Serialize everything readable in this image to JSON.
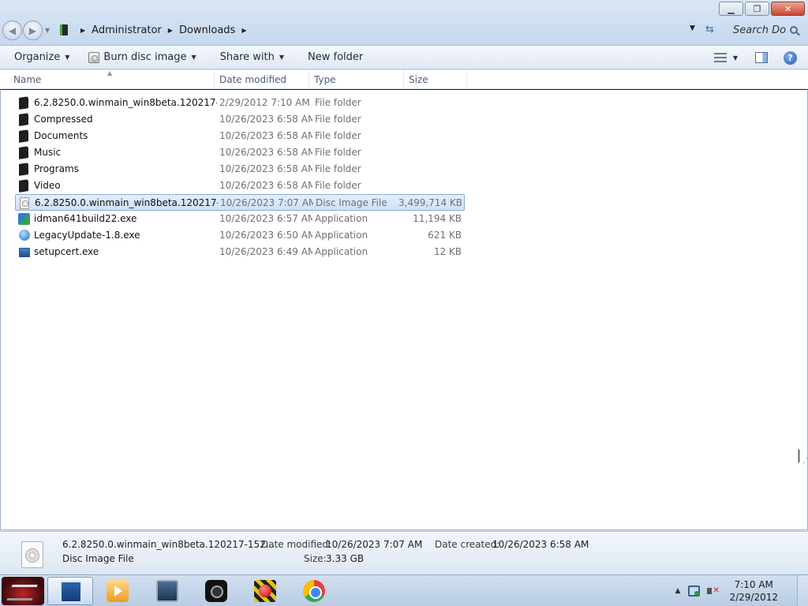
{
  "address": {
    "crumbs": [
      "Administrator",
      "Downloads"
    ],
    "search_placeholder": "Search Do..."
  },
  "toolbar": {
    "organize": "Organize",
    "burn": "Burn disc image",
    "share": "Share with",
    "new_folder": "New folder"
  },
  "columns": {
    "name": "Name",
    "date": "Date modified",
    "type": "Type",
    "size": "Size"
  },
  "files": [
    {
      "name": "6.2.8250.0.winmain_win8beta.120217-15...",
      "date": "2/29/2012 7:10 AM",
      "type": "File folder",
      "size": "",
      "icon": "folder-icon"
    },
    {
      "name": "Compressed",
      "date": "10/26/2023 6:58 AM",
      "type": "File folder",
      "size": "",
      "icon": "folder-icon"
    },
    {
      "name": "Documents",
      "date": "10/26/2023 6:58 AM",
      "type": "File folder",
      "size": "",
      "icon": "folder-icon"
    },
    {
      "name": "Music",
      "date": "10/26/2023 6:58 AM",
      "type": "File folder",
      "size": "",
      "icon": "folder-icon"
    },
    {
      "name": "Programs",
      "date": "10/26/2023 6:58 AM",
      "type": "File folder",
      "size": "",
      "icon": "folder-icon"
    },
    {
      "name": "Video",
      "date": "10/26/2023 6:58 AM",
      "type": "File folder",
      "size": "",
      "icon": "folder-icon"
    },
    {
      "name": "6.2.8250.0.winmain_win8beta.120217-15...",
      "date": "10/26/2023 7:07 AM",
      "type": "Disc Image File",
      "size": "3,499,714 KB",
      "icon": "disc-image-icon",
      "selected": true
    },
    {
      "name": "idman641build22.exe",
      "date": "10/26/2023 6:57 AM",
      "type": "Application",
      "size": "11,194 KB",
      "icon": "idm-icon"
    },
    {
      "name": "LegacyUpdate-1.8.exe",
      "date": "10/26/2023 6:50 AM",
      "type": "Application",
      "size": "621 KB",
      "icon": "legacy-update-icon"
    },
    {
      "name": "setupcert.exe",
      "date": "10/26/2023 6:49 AM",
      "type": "Application",
      "size": "12 KB",
      "icon": "setup-icon"
    }
  ],
  "details": {
    "name": "6.2.8250.0.winmain_win8beta.120217-152...",
    "type": "Disc Image File",
    "date_modified_label": "Date modified:",
    "date_modified": "10/26/2023 7:07 AM",
    "size_label": "Size:",
    "size": "3.33 GB",
    "date_created_label": "Date created:",
    "date_created": "10/26/2023 6:58 AM"
  },
  "taskbar": {
    "apps": [
      "explorer-icon",
      "media-player-icon",
      "remote-desktop-icon",
      "camera-icon",
      "recorder-icon",
      "chrome-icon"
    ],
    "time": "7:10 AM",
    "date": "2/29/2012"
  },
  "colors": {
    "selection_bg": "#cfe1f7",
    "selection_border": "#84acdd",
    "chrome_bg": "#dbe6f3"
  }
}
